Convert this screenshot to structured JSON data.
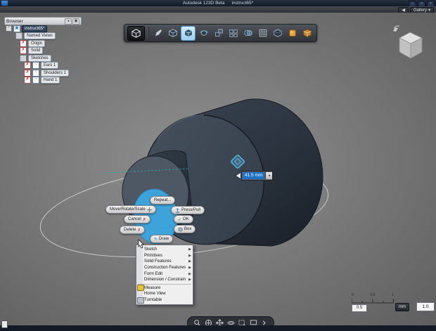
{
  "window": {
    "title_app": "Autodesk 123D Beta",
    "title_doc": "instruct65*",
    "minimize": "–",
    "maximize": "□",
    "close": "×"
  },
  "top_strip": {
    "back_arrow": "◀",
    "gallery_label": "Gallery",
    "gallery_caret": "▾"
  },
  "browser": {
    "header": "Browser",
    "collapse_button": "◂",
    "popout_button": "▣",
    "tree": [
      {
        "label": "instruct65*"
      },
      {
        "label": "Named Views"
      },
      {
        "label": "Origin"
      },
      {
        "label": "Solid"
      },
      {
        "label": "Sketches"
      },
      {
        "label": "Ears 1"
      },
      {
        "label": "Shoulders 1"
      },
      {
        "label": "Hand 1"
      }
    ]
  },
  "toolbar": {
    "icons": [
      "app-menu",
      "sketch",
      "primitive-box",
      "move",
      "rotate",
      "scale",
      "pattern",
      "combine",
      "grid",
      "shell",
      "material",
      "texture"
    ]
  },
  "marking_menu": {
    "repeat": "Repeat...",
    "move": "Move/Rotate/Scale",
    "press_pull": "Press/Pull",
    "cancel": "Cancel",
    "ok": "OK",
    "delete": "Delete",
    "box": "Box",
    "draw": "Draw",
    "cancel_icon": "✗",
    "ok_icon": "✓",
    "delete_icon": "✗",
    "draw_icon": "✎"
  },
  "context_submenu": {
    "items": [
      {
        "label": "Sketch",
        "submenu": true
      },
      {
        "label": "Primitives",
        "submenu": true
      },
      {
        "label": "Solid Features",
        "submenu": true
      },
      {
        "label": "Construction Features",
        "submenu": true
      },
      {
        "label": "Form Edit",
        "submenu": true
      },
      {
        "label": "Dimension / Constrain",
        "submenu": true
      },
      {
        "label": "Measure",
        "submenu": false
      },
      {
        "label": "Home View",
        "submenu": false
      },
      {
        "label": "Turntable",
        "submenu": false
      }
    ],
    "arrow": "▶"
  },
  "dimension_input": {
    "value": "41.5 mm",
    "spinner": "◂"
  },
  "scale_bar": {
    "tick_labels": [
      "0",
      "0.5",
      "1"
    ],
    "grid_value": "0.5",
    "unit_label": "mm",
    "scale_value": "1.0"
  },
  "colors": {
    "accent_blue": "#3ea6df",
    "selection_blue": "#1e73c8",
    "toolbar_highlight": "#bfe3f7",
    "model_body": "#2b3540"
  }
}
